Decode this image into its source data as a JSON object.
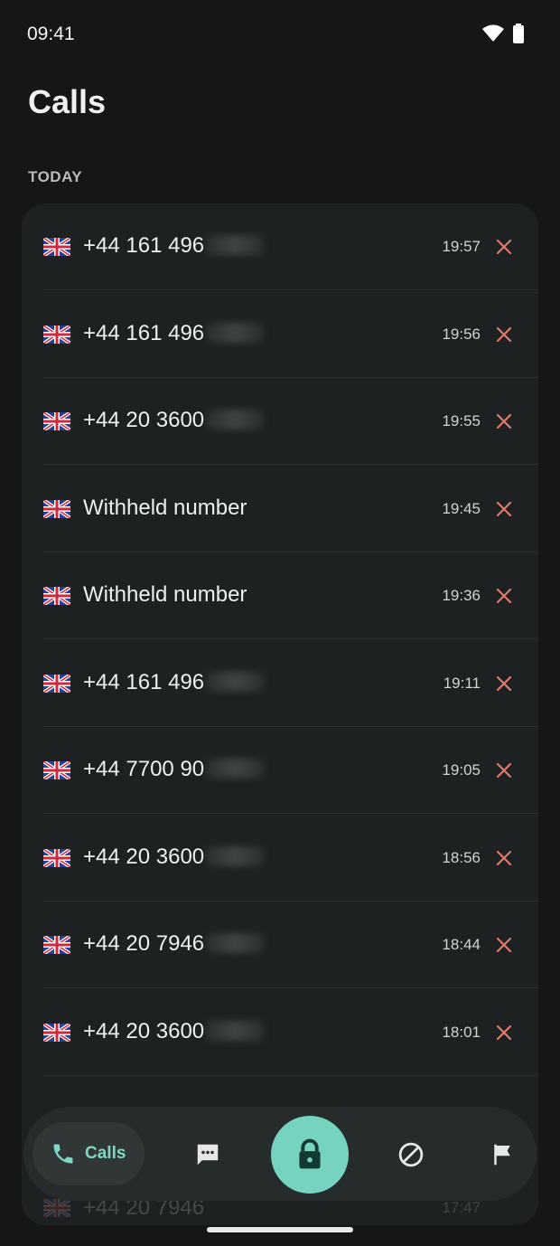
{
  "status_bar": {
    "time": "09:41"
  },
  "header": {
    "title": "Calls"
  },
  "section": {
    "label": "TODAY"
  },
  "calls": [
    {
      "number": "+44 161 496",
      "time": "19:57"
    },
    {
      "number": "+44 161 496",
      "time": "19:56"
    },
    {
      "number": "+44 20 3600",
      "time": "19:55"
    },
    {
      "number": "Withheld number",
      "time": "19:45",
      "withheld": true
    },
    {
      "number": "Withheld number",
      "time": "19:36",
      "withheld": true
    },
    {
      "number": "+44 161 496",
      "time": "19:11"
    },
    {
      "number": "+44 7700 90",
      "time": "19:05"
    },
    {
      "number": "+44 20 3600",
      "time": "18:56"
    },
    {
      "number": "+44 20 7946",
      "time": "18:44"
    },
    {
      "number": "+44 20 3600",
      "time": "18:01"
    }
  ],
  "partial_call": {
    "number": "+44 20 7946",
    "time": "17:47"
  },
  "nav": {
    "calls_label": "Calls",
    "items": [
      "phone-icon",
      "message-icon",
      "lock-icon",
      "block-icon",
      "flag-icon"
    ]
  },
  "colors": {
    "background": "#151717",
    "card": "#1d2121",
    "accent": "#75d3bf",
    "delete": "#e07a6a"
  }
}
